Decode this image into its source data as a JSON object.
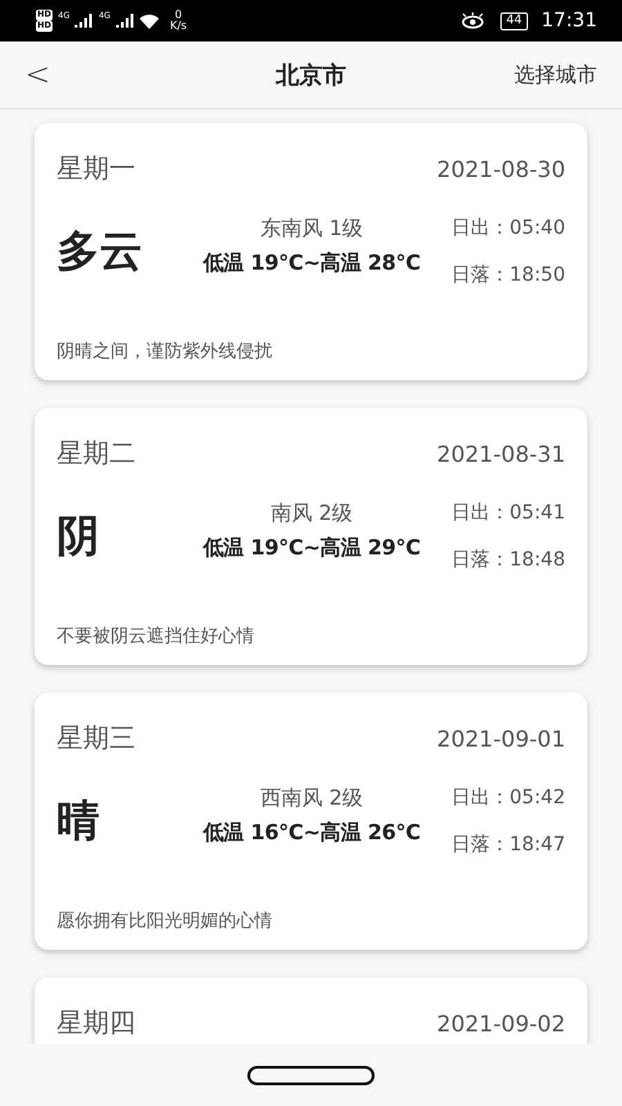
{
  "status_bar": {
    "sim_labels": [
      "HD",
      "HD"
    ],
    "network_labels": [
      "4G",
      "4G"
    ],
    "speed_value": "0",
    "speed_unit": "K/s",
    "battery": "44",
    "time": "17:31"
  },
  "header": {
    "back": "<",
    "title": "北京市",
    "action": "选择城市"
  },
  "days": [
    {
      "weekday": "星期一",
      "date": "2021-08-30",
      "weather": "多云",
      "wind": "东南风 1级",
      "temp": "低温 19℃~高温 28℃",
      "sunrise": "日出：05:40",
      "sunset": "日落：18:50",
      "tip": "阴晴之间，谨防紫外线侵扰"
    },
    {
      "weekday": "星期二",
      "date": "2021-08-31",
      "weather": "阴",
      "wind": "南风 2级",
      "temp": "低温 19℃~高温 29℃",
      "sunrise": "日出：05:41",
      "sunset": "日落：18:48",
      "tip": "不要被阴云遮挡住好心情"
    },
    {
      "weekday": "星期三",
      "date": "2021-09-01",
      "weather": "晴",
      "wind": "西南风 2级",
      "temp": "低温 16℃~高温 26℃",
      "sunrise": "日出：05:42",
      "sunset": "日落：18:47",
      "tip": "愿你拥有比阳光明媚的心情"
    },
    {
      "weekday": "星期四",
      "date": "2021-09-02"
    }
  ]
}
